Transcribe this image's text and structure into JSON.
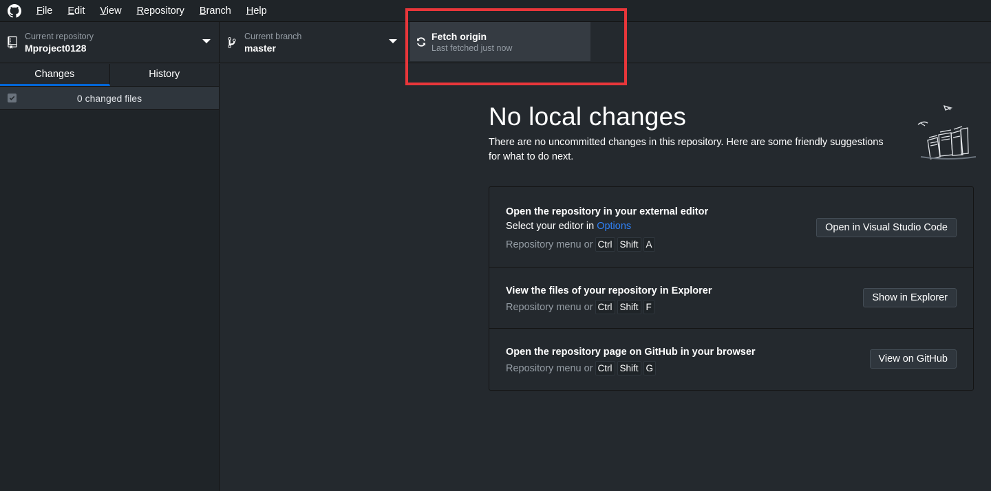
{
  "menu": {
    "items": [
      {
        "label": "File",
        "accel": "F",
        "rest": "ile"
      },
      {
        "label": "Edit",
        "accel": "E",
        "rest": "dit"
      },
      {
        "label": "View",
        "accel": "V",
        "rest": "iew"
      },
      {
        "label": "Repository",
        "accel": "R",
        "rest": "epository"
      },
      {
        "label": "Branch",
        "accel": "B",
        "rest": "ranch"
      },
      {
        "label": "Help",
        "accel": "H",
        "rest": "elp"
      }
    ]
  },
  "toolbar": {
    "repo_desc": "Current repository",
    "repo_title": "Mproject0128",
    "branch_desc": "Current branch",
    "branch_title": "master",
    "fetch_title": "Fetch origin",
    "fetch_desc": "Last fetched just now"
  },
  "sidebar": {
    "tabs": [
      "Changes",
      "History"
    ],
    "active_tab": "Changes",
    "changed_files": "0 changed files"
  },
  "main": {
    "title": "No local changes",
    "description": "There are no uncommitted changes in this repository. Here are some friendly suggestions for what to do next.",
    "actions": [
      {
        "title": "Open the repository in your external editor",
        "sub_prefix": "Select your editor in ",
        "sub_link": "Options",
        "shortcut_prefix": "Repository menu or",
        "keys": [
          "Ctrl",
          "Shift",
          "A"
        ],
        "button": "Open in Visual Studio Code"
      },
      {
        "title": "View the files of your repository in Explorer",
        "shortcut_prefix": "Repository menu or",
        "keys": [
          "Ctrl",
          "Shift",
          "F"
        ],
        "button": "Show in Explorer"
      },
      {
        "title": "Open the repository page on GitHub in your browser",
        "shortcut_prefix": "Repository menu or",
        "keys": [
          "Ctrl",
          "Shift",
          "G"
        ],
        "button": "View on GitHub"
      }
    ]
  },
  "colors": {
    "accent": "#0366d6",
    "link": "#2f81f7",
    "highlight": "#e8363a"
  }
}
